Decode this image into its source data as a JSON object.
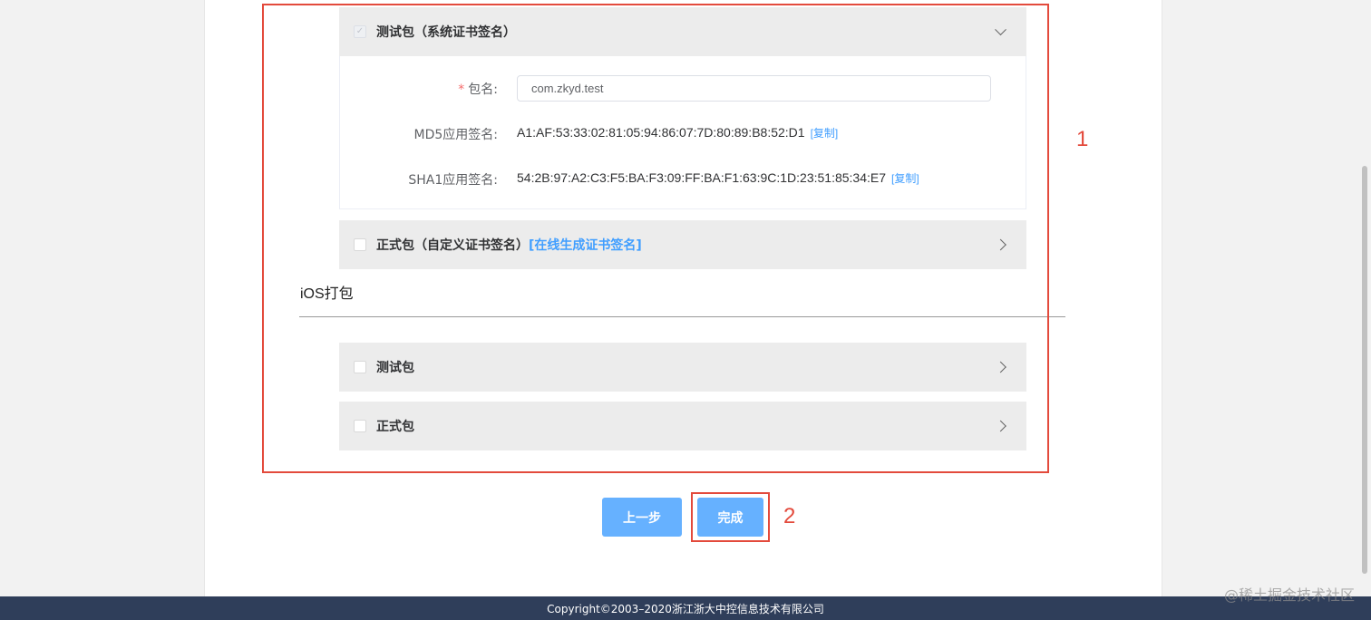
{
  "android": {
    "test_panel": {
      "title": "测试包（系统证书签名）",
      "expanded": true,
      "checked": true,
      "package_name": {
        "label": "包名:",
        "value": "com.zkyd.test"
      },
      "md5": {
        "label": "MD5应用签名:",
        "value": "A1:AF:53:33:02:81:05:94:86:07:7D:80:89:B8:52:D1",
        "copy_label": "[复制]"
      },
      "sha1": {
        "label": "SHA1应用签名:",
        "value": "54:2B:97:A2:C3:F5:BA:F3:09:FF:BA:F1:63:9C:1D:23:51:85:34:E7",
        "copy_label": "[复制]"
      }
    },
    "release_panel": {
      "title": "正式包（自定义证书签名）",
      "link": "[在线生成证书签名]",
      "expanded": false
    }
  },
  "ios": {
    "section_title": "iOS打包",
    "test_panel": {
      "title": "测试包",
      "expanded": false
    },
    "release_panel": {
      "title": "正式包",
      "expanded": false
    }
  },
  "actions": {
    "prev_label": "上一步",
    "finish_label": "完成"
  },
  "annotations": {
    "box1": "1",
    "box2": "2"
  },
  "footer": {
    "copyright": "Copyright©2003–2020浙江浙大中控信息技术有限公司"
  },
  "watermark": "@稀土掘金技术社区",
  "colors": {
    "accent": "#409eff",
    "button": "#66b1ff",
    "annotation": "#e34a3c",
    "footer_bg": "#2f3e5a"
  }
}
